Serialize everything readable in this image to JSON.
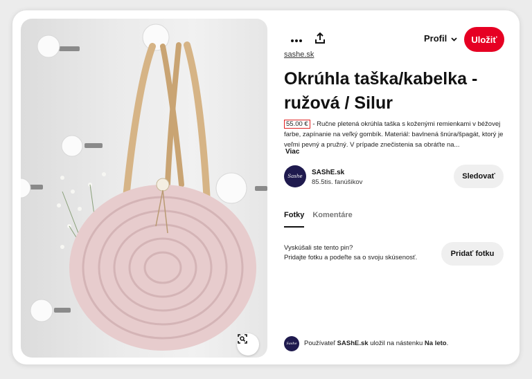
{
  "toolbar": {
    "more_icon": "more-dots-icon",
    "share_icon": "share-icon",
    "profile_label": "Profil",
    "save_label": "Uložiť"
  },
  "pin": {
    "source": "sashe.sk",
    "title": "Okrúhla taška/kabelka - ružová / Silur",
    "price": "55.00 €",
    "description": " - Ručne pletená okrúhla taška s koženými remienkami v béžovej farbe, zapínanie na veľký gombík. Materiál: bavlnená šnúra/špagát, ktorý je veľmi pevný a pružný. V prípade znečistenia sa obráťte na...",
    "more_label": "Viac"
  },
  "author": {
    "name": "SAShE.sk",
    "followers": "85.5tis. fanúšikov",
    "avatar_text": "Sashe",
    "follow_label": "Sledovať"
  },
  "tabs": [
    {
      "label": "Fotky",
      "active": true
    },
    {
      "label": "Komentáre",
      "active": false
    }
  ],
  "tried": {
    "question": "Vyskúšali ste tento pin?",
    "subtitle": "Pridajte fotku a podeľte sa o svoju skúsenosť.",
    "add_photo_label": "Pridať fotku"
  },
  "footer": {
    "prefix": "Používateľ ",
    "user": "SAShE.sk",
    "middle": " uložil na nástenku ",
    "board": "Na leto",
    "suffix": "."
  },
  "colors": {
    "accent": "#e60023",
    "price_highlight": "#e02020",
    "avatar_bg": "#1f1a4e"
  }
}
